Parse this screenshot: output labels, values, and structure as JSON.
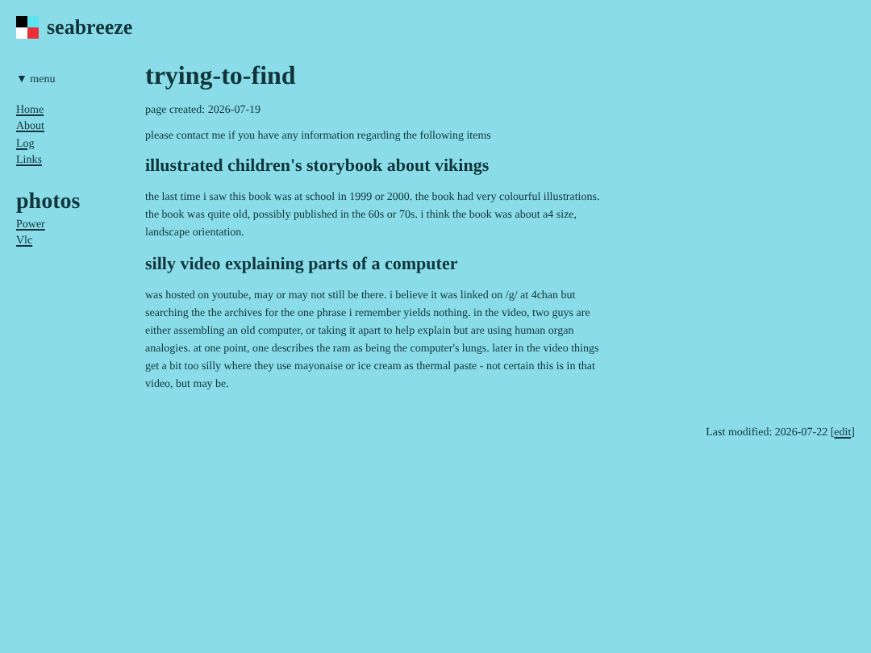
{
  "site": {
    "name": "seabreeze"
  },
  "menu": {
    "toggle": "▼",
    "label": "menu",
    "items": [
      "Home",
      "About",
      "Log",
      "Links"
    ]
  },
  "photos": {
    "title": "photos",
    "items": [
      "Power",
      "Vlc"
    ]
  },
  "page": {
    "title": "trying-to-find",
    "created": "page created: 2026-07-19",
    "intro": "please contact me if you have any information regarding the following items",
    "sections": [
      {
        "heading": "illustrated children's storybook about vikings",
        "text": "the last time i saw this book was at school in 1999 or 2000. the book had very colourful illustrations. the book was quite old, possibly published in the 60s or 70s. i think the book was about a4 size, landscape orientation."
      },
      {
        "heading": "silly video explaining parts of a computer",
        "text": "was hosted on youtube, may or may not still be there. i believe it was linked on /g/ at 4chan but searching the the archives for the one phrase i remember yields nothing. in the video, two guys are either assembling an old computer, or taking it apart to help explain but are using human organ analogies. at one point, one describes the ram as being the computer's lungs. later in the video things get a bit too silly where they use mayonaise or ice cream as thermal paste - not certain this is in that video, but may be."
      }
    ]
  },
  "footer": {
    "before": "Last modified: 2026-07-22 [",
    "link": "edit",
    "after": "]"
  }
}
